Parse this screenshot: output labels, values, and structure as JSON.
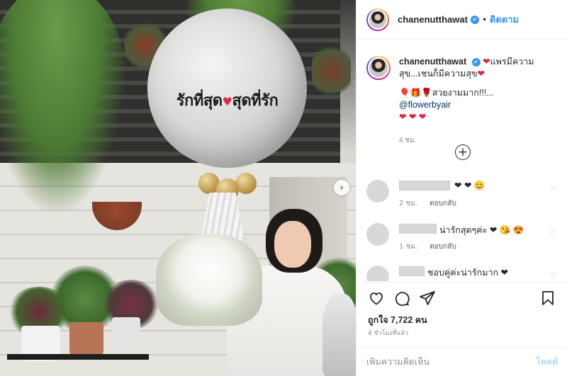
{
  "photo": {
    "balloon_text_left": "รักที่สุด",
    "balloon_text_right": "สุดที่รัก",
    "balloon_heart": "♥",
    "next_icon": "›"
  },
  "header": {
    "username": "chanenutthawat",
    "verified_icon": "✔",
    "separator": "•",
    "follow_label": "ติดตาม"
  },
  "caption": {
    "username": "chanenutthawat",
    "verified_icon": "✔",
    "line1_heart": "❤",
    "line1": "แพรมีความสุข...เชนก็มีความสุข",
    "line1_heart_end": "❤",
    "line2_icons": "🎈🎁🌹",
    "line2_text": "สวยงามมาก!!!...",
    "mention": "@flowerbyair",
    "line3_hearts": "❤ ❤ ❤",
    "ago": "4 ชม.",
    "plus_icon": "+"
  },
  "comments": [
    {
      "text": "❤ ❤ 😊",
      "time": "2 ชม.",
      "reply": "ตอบกลับ"
    },
    {
      "text": "น่ารักสุดๆค่ะ ❤ 😘 😍",
      "time": "1 ชม.",
      "reply": "ตอบกลับ"
    },
    {
      "text": "ชอบคู่ค่ะน่ารักมาก ❤",
      "time": "",
      "reply": ""
    }
  ],
  "comment_like_icon": "♡",
  "actions": {
    "like_icon": "heart-outline",
    "comment_icon": "speech-bubble",
    "share_icon": "paper-plane",
    "save_icon": "bookmark",
    "likes_text": "ถูกใจ 7,722 คน",
    "time_text": "4 ชั่วโมงที่แล้ว"
  },
  "add_comment": {
    "placeholder": "เพิ่มความคิดเห็น",
    "post_label": "โพสต์"
  },
  "colors": {
    "accent": "#3897f0",
    "heart_red": "#ed1b3b",
    "muted": "#8e8e8e",
    "post_disabled": "#b2dffc"
  }
}
